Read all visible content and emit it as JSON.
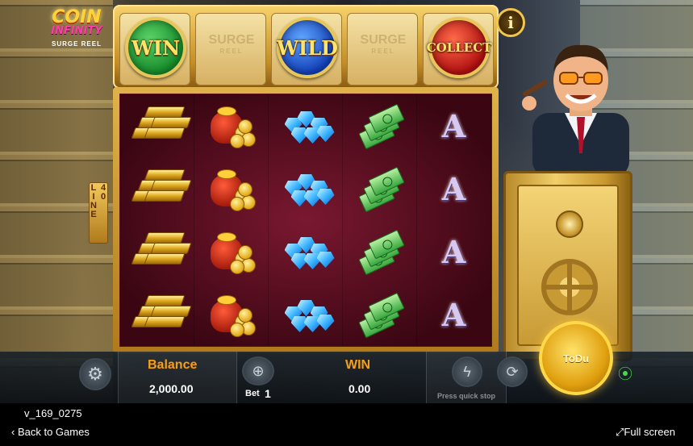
{
  "logo": {
    "line1": "COIN",
    "line2": "INFINITY",
    "line3": "SURGE REEL"
  },
  "top_coins": [
    {
      "kind": "win",
      "label": "WIN"
    },
    {
      "kind": "surge",
      "label": "SURGE",
      "sub": "REEL"
    },
    {
      "kind": "wild",
      "label": "WILD"
    },
    {
      "kind": "surge",
      "label": "SURGE",
      "sub": "REEL"
    },
    {
      "kind": "collect",
      "label": "COLLECT"
    }
  ],
  "info_button": "i",
  "lines_badge": "40 LINE",
  "reels": {
    "columns": [
      "gold-bars",
      "money-sack",
      "diamonds",
      "cash",
      "ace"
    ],
    "rows": 4,
    "ace_label": "A"
  },
  "controls": {
    "balance_label": "Balance",
    "balance_value": "2,000.00",
    "bet_label": "Bet",
    "bet_value": "1",
    "win_label": "WIN",
    "win_value": "0.00",
    "quick_stop_note": "Press quick stop",
    "spin_label": "ToDu"
  },
  "footer": {
    "version": "v_169_0275",
    "back": "Back to Games",
    "fullscreen": "Full screen"
  },
  "colors": {
    "accent_gold": "#f0a020",
    "win_green": "#168a2a",
    "wild_blue": "#1240b8",
    "collect_red": "#b01010"
  }
}
